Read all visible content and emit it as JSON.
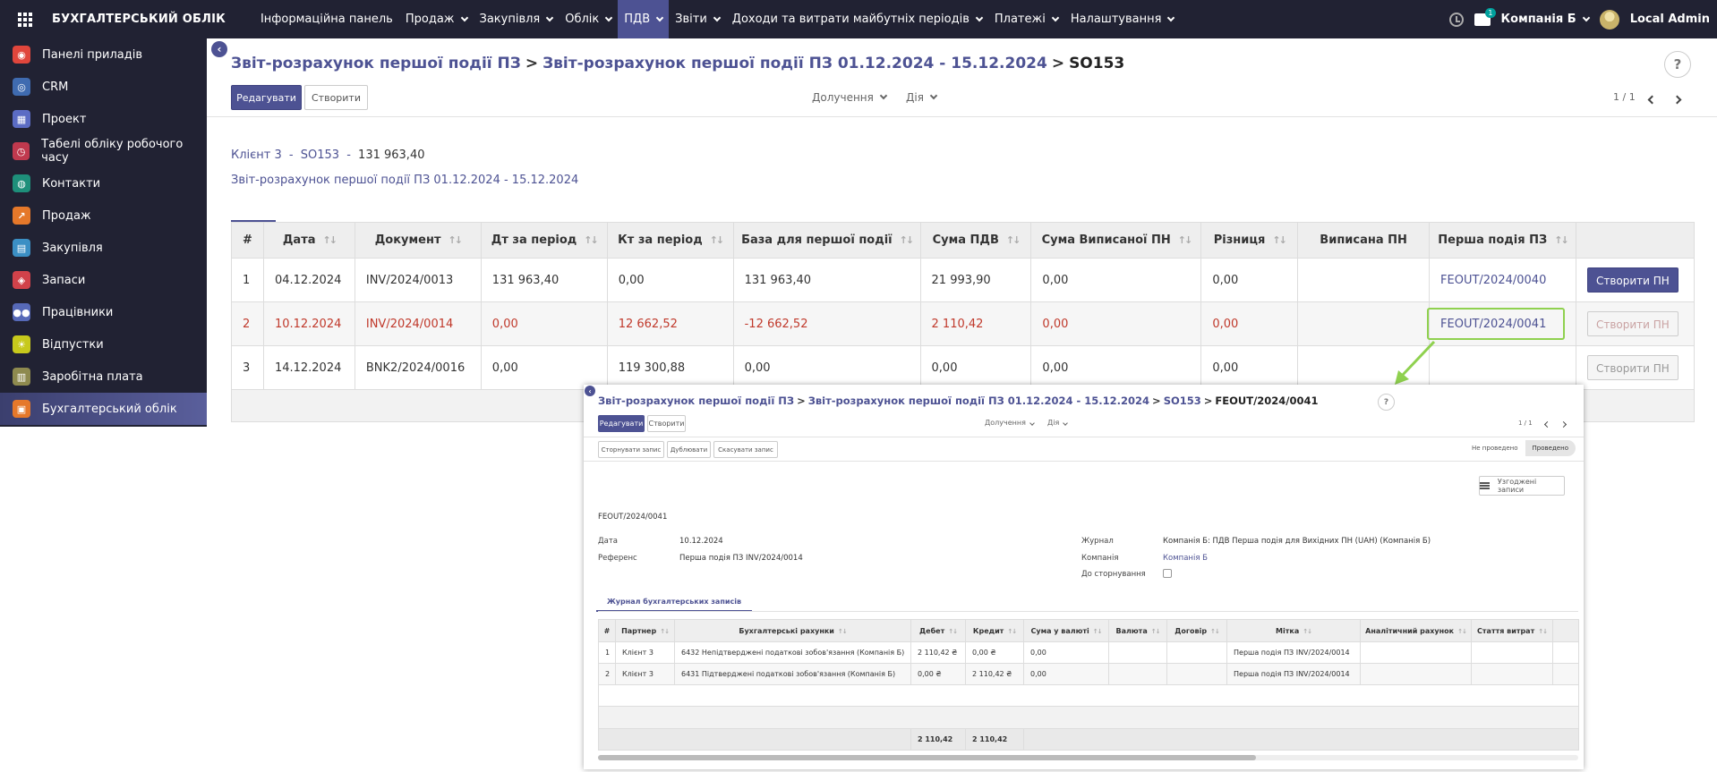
{
  "topbar": {
    "brand": "БУХГАЛТЕРСЬКИЙ ОБЛІК",
    "menu": [
      {
        "label": "Інформаційна панель",
        "dropdown": false
      },
      {
        "label": "Продаж",
        "dropdown": true
      },
      {
        "label": "Закупівля",
        "dropdown": true
      },
      {
        "label": "Облік",
        "dropdown": true
      },
      {
        "label": "ПДВ",
        "dropdown": true,
        "active": true
      },
      {
        "label": "Звіти",
        "dropdown": true
      },
      {
        "label": "Доходи та витрати майбутніх періодів",
        "dropdown": true
      },
      {
        "label": "Платежі",
        "dropdown": true
      },
      {
        "label": "Налаштування",
        "dropdown": true
      }
    ],
    "chat_badge": "1",
    "company": "Компанія Б",
    "user": "Local Admin"
  },
  "sidebar": {
    "items": [
      {
        "label": "Панелі приладів",
        "icon": "dashboard-icon",
        "color": "#e0463c"
      },
      {
        "label": "CRM",
        "icon": "crm-icon",
        "color": "#3f6bb0"
      },
      {
        "label": "Проект",
        "icon": "project-icon",
        "color": "#5b6cc4"
      },
      {
        "label": "Табелі обліку робочого часу",
        "icon": "timesheet-icon",
        "color": "#c0394e"
      },
      {
        "label": "Контакти",
        "icon": "contacts-icon",
        "color": "#1e8f7a"
      },
      {
        "label": "Продаж",
        "icon": "sales-icon",
        "color": "#e5782a"
      },
      {
        "label": "Закупівля",
        "icon": "purchase-icon",
        "color": "#3b8fc4"
      },
      {
        "label": "Запаси",
        "icon": "inventory-icon",
        "color": "#d0424a"
      },
      {
        "label": "Працівники",
        "icon": "employees-icon",
        "color": "#5669b8"
      },
      {
        "label": "Відпустки",
        "icon": "leaves-icon",
        "color": "#c7c91c"
      },
      {
        "label": "Заробітна плата",
        "icon": "payroll-icon",
        "color": "#8e8a4f"
      },
      {
        "label": "Бухгалтерський облік",
        "icon": "accounting-icon",
        "color": "#e5782a",
        "active": true
      }
    ]
  },
  "breadcrumb": {
    "items": [
      "Звіт-розрахунок першої події ПЗ",
      "Звіт-розрахунок першої події ПЗ 01.12.2024 - 15.12.2024"
    ],
    "current": "SO153"
  },
  "help": "?",
  "toolbar": {
    "edit": "Редагувати",
    "create": "Створити",
    "attachments": "Долучення",
    "action": "Дія",
    "pager": "1 / 1"
  },
  "info": {
    "client": "Клієнт 3",
    "sep": "-",
    "document": "SO153",
    "amount": "131 963,40",
    "report": "Звіт-розрахунок першої події ПЗ 01.12.2024 - 15.12.2024"
  },
  "main_table": {
    "headers": [
      "#",
      "Дата",
      "Документ",
      "Дт за період",
      "Кт за період",
      "База для першої події",
      "Сума ПДВ",
      "Сума Виписаної ПН",
      "Різниця",
      "Виписана ПН",
      "Перша подія ПЗ",
      ""
    ],
    "rows": [
      {
        "n": "1",
        "date": "04.12.2024",
        "doc": "INV/2024/0013",
        "dt": "131 963,40",
        "kt": "0,00",
        "base": "131 963,40",
        "vat": "21 993,90",
        "issued_sum": "0,00",
        "diff": "0,00",
        "issued": "",
        "first_event": "FEOUT/2024/0040",
        "action": "Створити ПН",
        "action_enabled": true,
        "red": false
      },
      {
        "n": "2",
        "date": "10.12.2024",
        "doc": "INV/2024/0014",
        "dt": "0,00",
        "kt": "12 662,52",
        "base": "-12 662,52",
        "vat": "2 110,42",
        "issued_sum": "0,00",
        "diff": "0,00",
        "issued": "",
        "first_event": "FEOUT/2024/0041",
        "action": "Створити ПН",
        "action_enabled": false,
        "red": true
      },
      {
        "n": "3",
        "date": "14.12.2024",
        "doc": "BNK2/2024/0016",
        "dt": "0,00",
        "kt": "119 300,88",
        "base": "0,00",
        "vat": "0,00",
        "issued_sum": "0,00",
        "diff": "0,00",
        "issued": "",
        "first_event": "",
        "action": "Створити ПН",
        "action_enabled": false,
        "red": false
      }
    ]
  },
  "popup": {
    "breadcrumb": {
      "items": [
        "Звіт-розрахунок першої події ПЗ",
        "Звіт-розрахунок першої події ПЗ 01.12.2024 - 15.12.2024",
        "SO153"
      ],
      "current": "FEOUT/2024/0041"
    },
    "help": "?",
    "edit": "Редагувати",
    "create": "Створити",
    "attachments": "Долучення",
    "action": "Дія",
    "pager": "1 / 1",
    "buttons": [
      "Сторнувати запис",
      "Дублювати",
      "Скасувати запис"
    ],
    "status": {
      "draft": "Не проведено",
      "posted": "Проведено"
    },
    "reconciled": "Узгоджені записи",
    "name": "FEOUT/2024/0041",
    "fields": {
      "date_label": "Дата",
      "date": "10.12.2024",
      "ref_label": "Референс",
      "ref": "Перша подія ПЗ INV/2024/0014",
      "journal_label": "Журнал",
      "journal": "Компанія Б: ПДВ Перша подія для Вихідних ПН (UAH) (Компанія Б)",
      "company_label": "Компанія",
      "company": "Компанія Б",
      "reverse_label": "До сторнування"
    },
    "tab": "Журнал бухгалтерських записів",
    "table": {
      "headers": [
        "#",
        "Партнер",
        "Бухгалтерські рахунки",
        "Дебет",
        "Кредит",
        "Сума у валюті",
        "Валюта",
        "Договір",
        "Мітка",
        "Аналітичний рахунок",
        "Стаття витрат"
      ],
      "rows": [
        {
          "n": "1",
          "partner": "Клієнт 3",
          "account": "6432 Непідтверджені податкові зобов'язання (Компанія Б)",
          "debit": "2 110,42 ₴",
          "credit": "0,00 ₴",
          "amount_currency": "0,00",
          "currency": "",
          "contract": "",
          "label": "Перша подія ПЗ INV/2024/0014",
          "analytic": "",
          "expense": ""
        },
        {
          "n": "2",
          "partner": "Клієнт 3",
          "account": "6431 Підтверджені податкові зобов'язання (Компанія Б)",
          "debit": "0,00 ₴",
          "credit": "2 110,42 ₴",
          "amount_currency": "0,00",
          "currency": "",
          "contract": "",
          "label": "Перша подія ПЗ INV/2024/0014",
          "analytic": "",
          "expense": ""
        }
      ],
      "total_debit": "2 110,42",
      "total_credit": "2 110,42"
    }
  },
  "colors": {
    "brand": "#4d5293",
    "navbar": "#212233",
    "highlight": "#8fd14f",
    "negative": "#c0392b"
  }
}
